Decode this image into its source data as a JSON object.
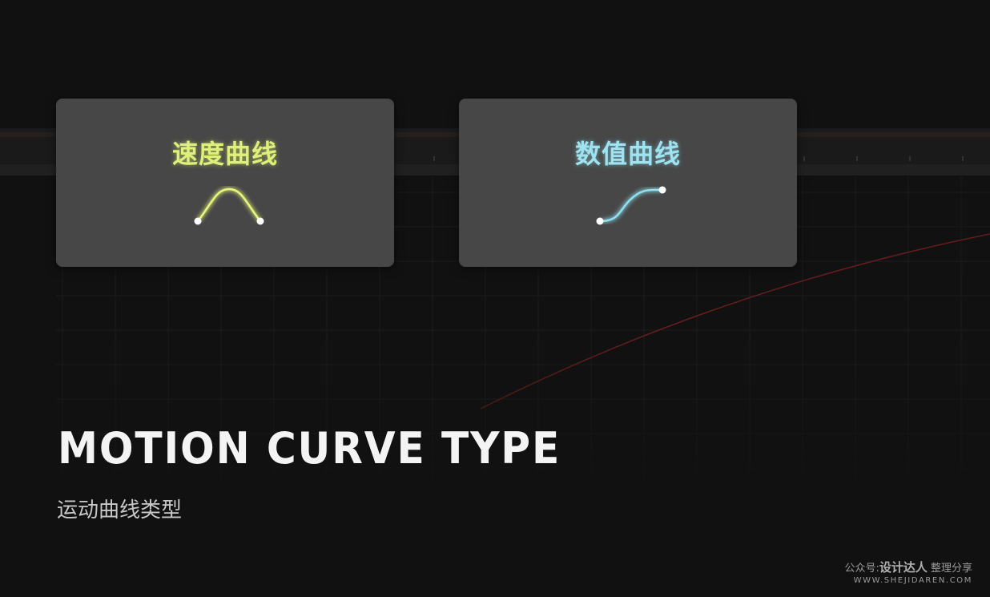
{
  "cards": [
    {
      "title": "速度曲线",
      "icon": "bell-curve-icon",
      "color": "#dff07a"
    },
    {
      "title": "数值曲线",
      "icon": "s-curve-icon",
      "color": "#9fe3f0"
    }
  ],
  "heading": "MOTION CURVE TYPE",
  "subheading": "运动曲线类型",
  "watermark": {
    "prefix": "公众号:",
    "name": "设计达人",
    "suffix": "整理分享",
    "url": "WWW.SHEJIDAREN.COM"
  },
  "colors": {
    "background": "#111111",
    "card": "#474747",
    "red_curve": "#6a1e1e"
  }
}
